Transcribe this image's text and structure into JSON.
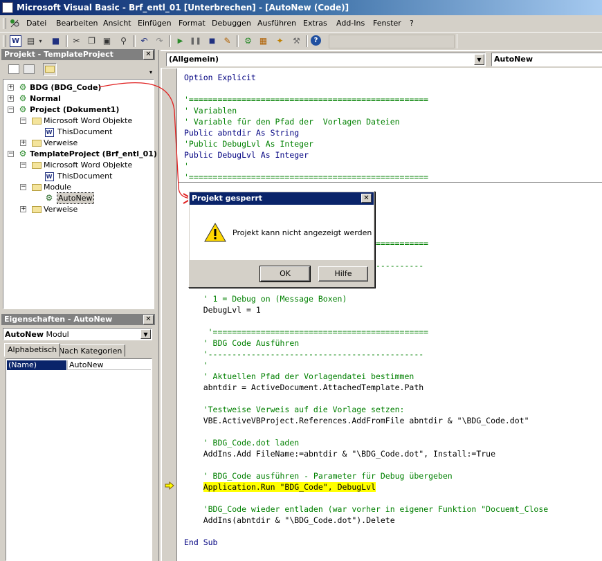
{
  "window": {
    "title": "Microsoft Visual Basic - Brf_entl_01 [Unterbrechen] - [AutoNew (Code)]"
  },
  "menu": [
    "Datei",
    "Bearbeiten",
    "Ansicht",
    "Einfügen",
    "Format",
    "Debuggen",
    "Ausführen",
    "Extras",
    "Add-Ins",
    "Fenster",
    "?"
  ],
  "toolbar_icons": [
    "view-word-icon",
    "insert-module-icon",
    "save-icon",
    "cut-icon",
    "copy-icon",
    "paste-icon",
    "find-icon",
    "undo-icon",
    "redo-icon",
    "run-icon",
    "break-icon",
    "reset-icon",
    "design-mode-icon",
    "project-explorer-icon",
    "properties-window-icon",
    "object-browser-icon",
    "toolbox-icon",
    "help-icon"
  ],
  "project_pane": {
    "title": "Projekt - TemplateProject",
    "nodes": [
      {
        "label": "BDG (BDG_Code)",
        "bold": true,
        "icon": "vba-project-icon"
      },
      {
        "label": "Normal",
        "bold": true,
        "icon": "vba-project-icon"
      },
      {
        "label": "Project (Dokument1)",
        "bold": true,
        "icon": "vba-project-icon"
      },
      {
        "label": "Microsoft Word Objekte",
        "icon": "folder-icon"
      },
      {
        "label": "ThisDocument",
        "icon": "word-document-icon"
      },
      {
        "label": "Verweise",
        "icon": "folder-icon"
      },
      {
        "label": "TemplateProject (Brf_entl_01)",
        "bold": true,
        "icon": "vba-project-icon"
      },
      {
        "label": "Microsoft Word Objekte",
        "icon": "folder-icon"
      },
      {
        "label": "ThisDocument",
        "icon": "word-document-icon"
      },
      {
        "label": "Module",
        "icon": "folder-icon"
      },
      {
        "label": "AutoNew",
        "icon": "module-icon",
        "selected": true
      },
      {
        "label": "Verweise",
        "icon": "folder-icon"
      }
    ]
  },
  "props_pane": {
    "title": "Eigenschaften - AutoNew",
    "object_name": "AutoNew",
    "object_type": "Modul",
    "tabs": [
      "Alphabetisch",
      "Nach Kategorien"
    ],
    "row_name": "(Name)",
    "row_value": "AutoNew"
  },
  "code_window": {
    "object_combo": "(Allgemein)",
    "proc_combo": "AutoNew",
    "lines_top": [
      {
        "t": "Option Explicit",
        "c": "kw"
      },
      {
        "t": "",
        "c": "tx"
      },
      {
        "t": "'==================================================",
        "c": "cm"
      },
      {
        "t": "' Variablen",
        "c": "cm"
      },
      {
        "t": "' Variable für den Pfad der  Vorlagen Dateien",
        "c": "cm"
      },
      {
        "t": "Public abntdir As String",
        "c": "kw"
      },
      {
        "t": "'Public DebugLvl As Integer",
        "c": "cm"
      },
      {
        "t": "Public DebugLvl As Integer",
        "c": "kw"
      },
      {
        "t": "'",
        "c": "cm"
      },
      {
        "t": "'==================================================",
        "c": "cm"
      }
    ],
    "lines_mid": [
      {
        "t": "    '",
        "c": "cm",
        "n": 6
      },
      {
        "t": "    ' =============================================",
        "c": "cm",
        "n": 15
      },
      {
        "t": "    '",
        "c": "cm",
        "n": 17
      },
      {
        "t": "    '---------------------------------------------",
        "c": "cm",
        "n": 17
      }
    ],
    "lines_bottom": [
      {
        "t": "    ' 1 = Debug on (Message Boxen)",
        "c": "cm"
      },
      {
        "t": "    DebugLvl = 1",
        "c": "tx"
      },
      {
        "t": "",
        "c": "tx"
      },
      {
        "t": "     '=============================================",
        "c": "cm"
      },
      {
        "t": "    ' BDG Code Ausführen",
        "c": "cm"
      },
      {
        "t": "    '---------------------------------------------",
        "c": "cm"
      },
      {
        "t": "    '",
        "c": "cm"
      },
      {
        "t": "    ' Aktuellen Pfad der Vorlagendatei bestimmen",
        "c": "cm"
      },
      {
        "t": "    abntdir = ActiveDocument.AttachedTemplate.Path",
        "c": "tx"
      },
      {
        "t": "",
        "c": "tx"
      },
      {
        "t": "    'Testweise Verweis auf die Vorlage setzen:",
        "c": "cm"
      },
      {
        "t": "    VBE.ActiveVBProject.References.AddFromFile abntdir & \"\\BDG_Code.dot\"",
        "c": "tx"
      },
      {
        "t": "",
        "c": "tx"
      },
      {
        "t": "    ' BDG_Code.dot laden",
        "c": "cm"
      },
      {
        "t": "    AddIns.Add FileName:=abntdir & \"\\BDG_Code.dot\", Install:=True",
        "c": "tx"
      },
      {
        "t": "",
        "c": "tx"
      },
      {
        "t": "    ' BDG_Code ausführen - Parameter für Debug übergeben",
        "c": "cm"
      },
      {
        "t": "    Application.Run \"BDG_Code\", DebugLvl",
        "c": "tx",
        "highlight": true
      },
      {
        "t": "",
        "c": "tx"
      },
      {
        "t": "    'BDG_Code wieder entladen (war vorher in eigener Funktion \"Docuemt_Close",
        "c": "cm"
      },
      {
        "t": "    AddIns(abntdir & \"\\BDG_Code.dot\").Delete",
        "c": "tx"
      },
      {
        "t": "",
        "c": "tx"
      },
      {
        "t": "End Sub",
        "c": "kw"
      }
    ]
  },
  "dialog": {
    "title": "Projekt gesperrt",
    "message": "Projekt kann nicht angezeigt werden",
    "ok": "OK",
    "help": "Hilfe"
  },
  "colors": {
    "comment": "#008000",
    "keyword": "#000080",
    "highlight": "#ffff00",
    "annotation_arrow": "#e02020"
  }
}
